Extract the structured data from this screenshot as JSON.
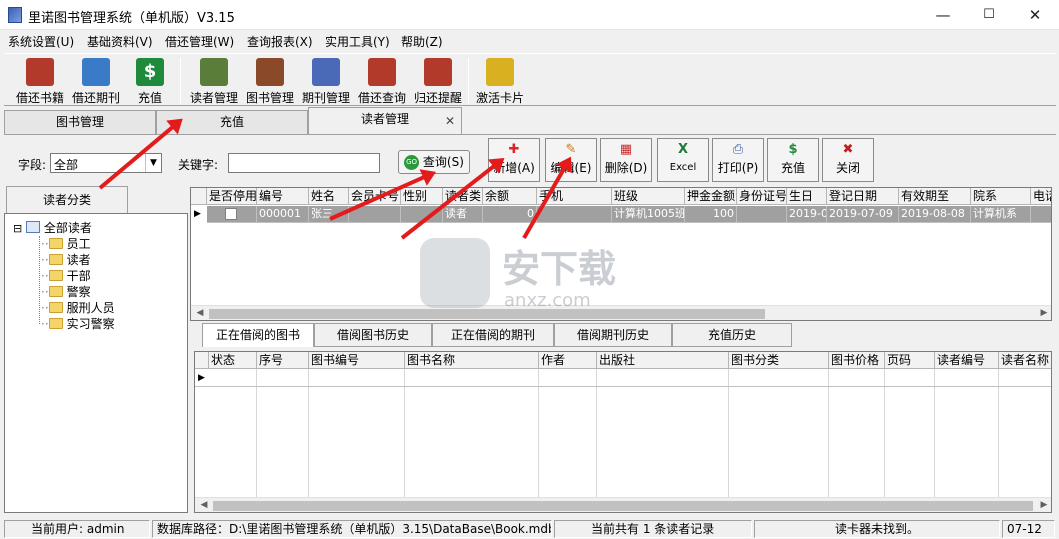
{
  "window": {
    "title": "里诺图书管理系统（单机版）V3.15",
    "min": "—",
    "max": "☐",
    "close": "✕"
  },
  "menu": [
    "系统设置(U)",
    "基础资料(V)",
    "借还管理(W)",
    "查询报表(X)",
    "实用工具(Y)",
    "帮助(Z)"
  ],
  "toolbar": [
    {
      "label": "借还书籍",
      "icon": "book-lend-icon",
      "color": "#b23a2a"
    },
    {
      "label": "借还期刊",
      "icon": "magazine-search-icon",
      "color": "#3a7bc8"
    },
    {
      "label": "充值",
      "icon": "dollar-icon",
      "color": "#1f8a3a"
    },
    {
      "label": "读者管理",
      "icon": "users-icon",
      "color": "#5a7d3a"
    },
    {
      "label": "图书管理",
      "icon": "books-icon",
      "color": "#8a4a2a"
    },
    {
      "label": "期刊管理",
      "icon": "document-icon",
      "color": "#4a6ab8"
    },
    {
      "label": "借还查询",
      "icon": "book-search-icon",
      "color": "#b23a2a"
    },
    {
      "label": "归还提醒",
      "icon": "book-reminder-icon",
      "color": "#b23a2a"
    },
    {
      "label": "激活卡片",
      "icon": "card-icon",
      "color": "#d8b020"
    }
  ],
  "tabs": [
    "图书管理",
    "充值",
    "读者管理"
  ],
  "tab_close": "✕",
  "search": {
    "field_label": "字段:",
    "field_value": "全部",
    "keyword_label": "关键字:",
    "keyword_value": "",
    "query_button": "查询(S)",
    "go_badge": "GO"
  },
  "actions": [
    {
      "label": "新增(A)",
      "icon": "add-icon",
      "glyph": "✚",
      "color": "#d9262b"
    },
    {
      "label": "编辑(E)",
      "icon": "edit-icon",
      "glyph": "✎",
      "color": "#c07a20"
    },
    {
      "label": "删除(D)",
      "icon": "delete-icon",
      "glyph": "▦",
      "color": "#c03030"
    },
    {
      "label": "Excel",
      "icon": "excel-icon",
      "glyph": "X",
      "color": "#1f7a3a"
    },
    {
      "label": "打印(P)",
      "icon": "print-icon",
      "glyph": "⎙",
      "color": "#3a5aa8"
    },
    {
      "label": "充值",
      "icon": "dollar-icon",
      "glyph": "$",
      "color": "#1f8a3a"
    },
    {
      "label": "关闭",
      "icon": "close-icon",
      "glyph": "✖",
      "color": "#c02020"
    }
  ],
  "sidebar": {
    "tab": "读者分类",
    "root": "全部读者",
    "root_toggle": "⊟",
    "items": [
      "员工",
      "读者",
      "干部",
      "警察",
      "服刑人员",
      "实习警察"
    ]
  },
  "readers_table": {
    "columns": [
      "是否停用",
      "编号",
      "姓名",
      "会员卡号",
      "性别",
      "读者类",
      "余额",
      "手机",
      "班级",
      "押金金额",
      "身份证号",
      "生日",
      "登记日期",
      "有效期至",
      "院系",
      "电话"
    ],
    "rows": [
      [
        "",
        "000001",
        "张三",
        "",
        "",
        "读者",
        "0",
        "",
        "计算机1005班",
        "100",
        "",
        "2019-0",
        "2019-07-09",
        "2019-08-08",
        "计算机系",
        ""
      ]
    ]
  },
  "bottom_tabs": [
    "正在借阅的图书",
    "借阅图书历史",
    "正在借阅的期刊",
    "借阅期刊历史",
    "充值历史"
  ],
  "loans_table": {
    "columns": [
      "状态",
      "序号",
      "图书编号",
      "图书名称",
      "作者",
      "出版社",
      "图书分类",
      "图书价格",
      "页码",
      "读者编号",
      "读者名称"
    ]
  },
  "status": {
    "user": "当前用户: admin",
    "db": "数据库路径：D:\\里诺图书管理系统（单机版）3.15\\DataBase\\Book.mdb",
    "count": "当前共有 1 条读者记录",
    "reader": "读卡器未找到。",
    "date": "07-12"
  },
  "watermark": {
    "title": "安下载",
    "sub": "anxz.com"
  },
  "scroll_glyphs": {
    "left": "◀",
    "right": "▶",
    "row_marker": "▶"
  },
  "colors": {
    "annotation_arrow": "#e31b1b",
    "selected_row": "#a0a0a0"
  }
}
